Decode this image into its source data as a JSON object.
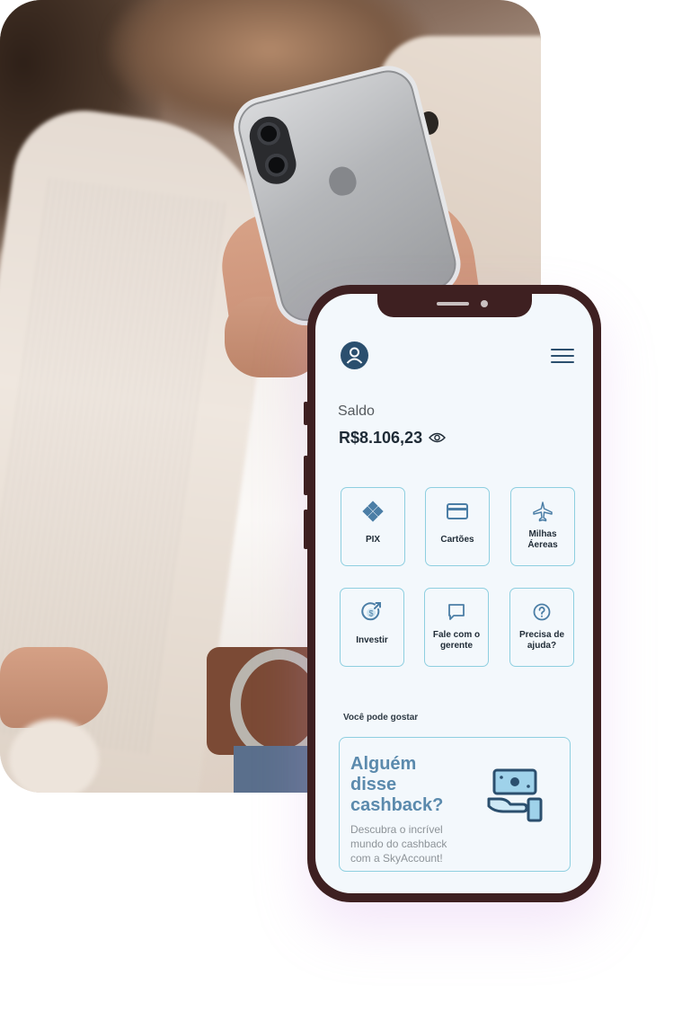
{
  "colors": {
    "phone_frame": "#3e2021",
    "screen_bg": "#f3f8fc",
    "accent_border": "#8ecfe0",
    "primary_dark": "#2b4f6e",
    "promo_title": "#5b8aad"
  },
  "header": {
    "avatar_icon": "user-circle-icon",
    "menu_icon": "hamburger-menu-icon"
  },
  "balance": {
    "label": "Saldo",
    "value": "R$8.106,23",
    "toggle_icon": "eye-icon"
  },
  "actions": [
    {
      "label": "PIX",
      "icon": "pix-icon"
    },
    {
      "label": "Cartões",
      "icon": "credit-card-icon"
    },
    {
      "label": "Milhas\nÁereas",
      "icon": "airplane-icon"
    },
    {
      "label": "Investir",
      "icon": "investment-coin-icon"
    },
    {
      "label": "Fale com o\ngerente",
      "icon": "chat-bubble-icon"
    },
    {
      "label": "Precisa de\najuda?",
      "icon": "help-circle-icon"
    }
  ],
  "suggestions": {
    "title": "Você pode gostar",
    "card": {
      "title": "Alguém\ndisse\ncashback?",
      "description": "Descubra o incrível\nmundo do cashback\ncom a SkyAccount!",
      "icon": "cashback-hand-money-icon"
    }
  }
}
